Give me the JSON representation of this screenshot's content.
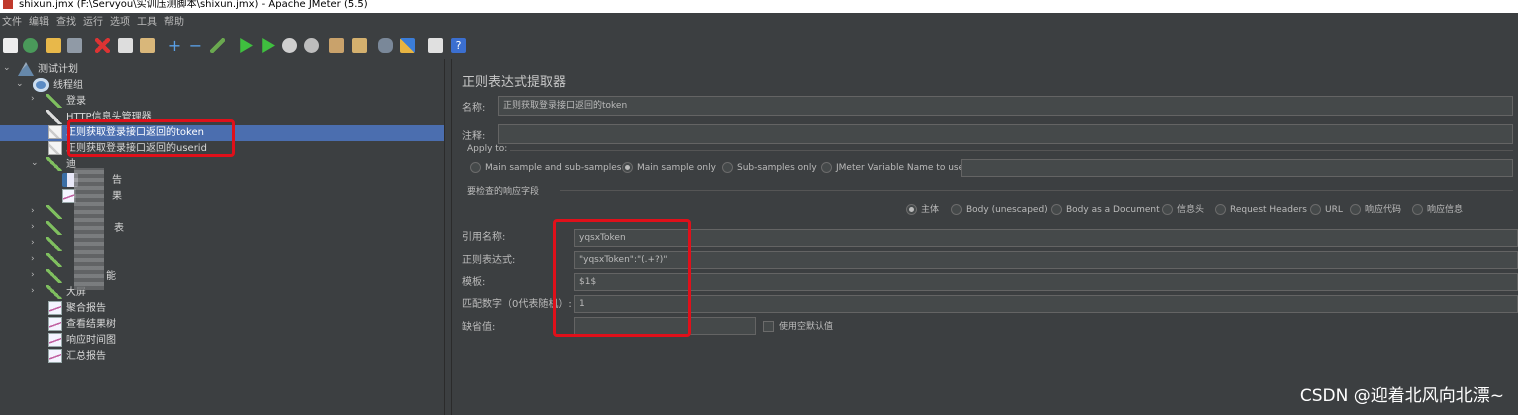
{
  "window": {
    "title": "shixun.jmx (F:\\Servyou\\实训压测脚本\\shixun.jmx) - Apache JMeter (5.5)"
  },
  "menu": [
    "文件",
    "编辑",
    "查找",
    "运行",
    "选项",
    "工具",
    "帮助"
  ],
  "toolbar": [
    "new-icon",
    "templates-icon",
    "open-icon",
    "save-icon",
    "cut-icon",
    "copy-icon",
    "paste-icon",
    "expand-icon",
    "collapse-icon",
    "toggle-icon",
    "start-icon",
    "start-no-pause-icon",
    "stop-icon",
    "shutdown-icon",
    "clear-icon",
    "clear-all-icon",
    "search-icon",
    "reset-search-icon",
    "function-helper-icon",
    "help-icon"
  ],
  "tree": {
    "test_plan": "测试计划",
    "thread_group": "线程组",
    "login": "登录",
    "http_header": "HTTP信息头管理器",
    "extractor_token": "正则获取登录接口返回的token",
    "extractor_userid": "正则获取登录接口返回的userid",
    "blurred_a": "迪",
    "blurred_b": "告",
    "blurred_c": "果",
    "blurred_d": "表",
    "blurred_e": "能",
    "big": "大屏",
    "aggregate": "聚合报告",
    "results_tree": "查看结果树",
    "response_time": "响应时间图",
    "summary": "汇总报告"
  },
  "panel": {
    "title": "正则表达式提取器",
    "name_label": "名称:",
    "name_value": "正则获取登录接口返回的token",
    "comment_label": "注释:",
    "comment_value": "",
    "apply_to": {
      "label": "Apply to:",
      "options": [
        "Main sample and sub-samples",
        "Main sample only",
        "Sub-samples only",
        "JMeter Variable Name to use"
      ],
      "selected": "Main sample only",
      "var_value": ""
    },
    "field_check": {
      "label": "要检查的响应字段",
      "options": [
        "主体",
        "Body (unescaped)",
        "Body as a Document",
        "信息头",
        "Request Headers",
        "URL",
        "响应代码",
        "响应信息"
      ],
      "selected": "主体"
    },
    "ref_label": "引用名称:",
    "ref_value": "yqsxToken",
    "regex_label": "正则表达式:",
    "regex_value": "\"yqsxToken\":\"(.+?)\"",
    "template_label": "模板:",
    "template_value": "$1$",
    "match_label": "匹配数字（0代表随机）:",
    "match_value": "1",
    "default_label": "缺省值:",
    "default_value": "",
    "empty_default_label": "使用空默认值"
  },
  "watermark": "CSDN @迎着北风向北漂~",
  "colors": {
    "background": "#3c3f41",
    "selection": "#4b6eaf",
    "highlight_box": "#e0101a"
  }
}
